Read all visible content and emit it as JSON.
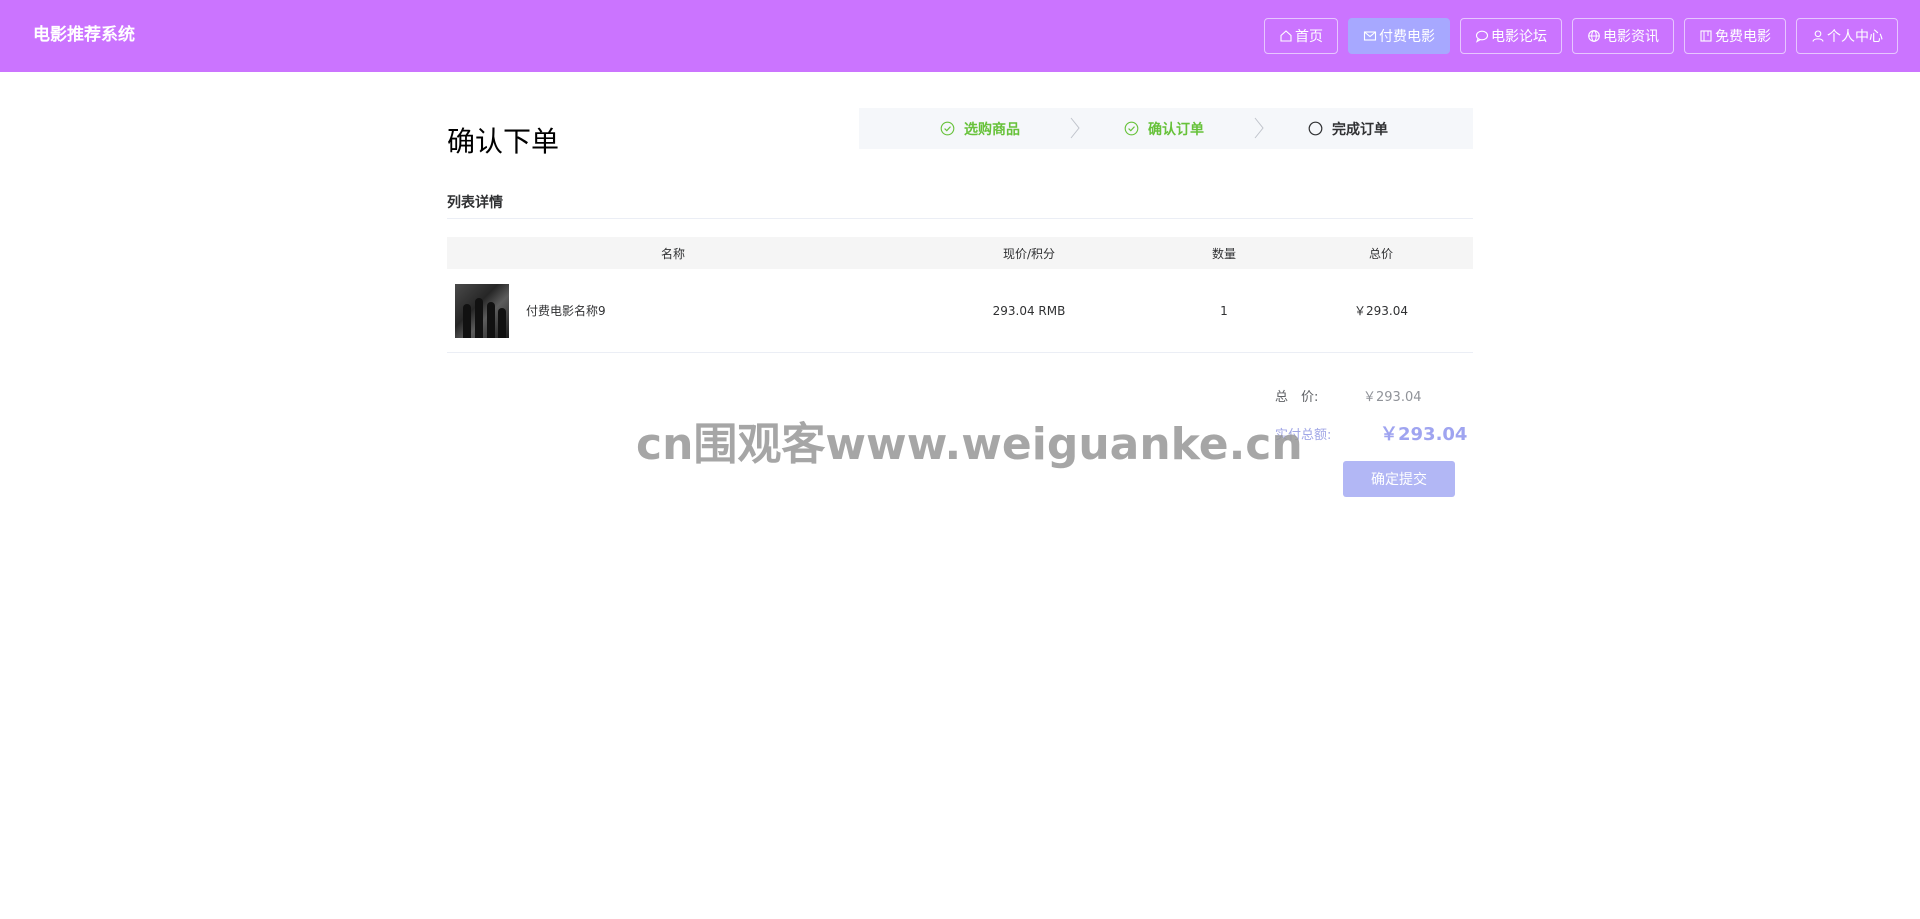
{
  "header": {
    "brand": "电影推荐系统",
    "nav": [
      {
        "label": "首页",
        "icon": "home-icon"
      },
      {
        "label": "付费电影",
        "icon": "mail-icon",
        "active": true
      },
      {
        "label": "电影论坛",
        "icon": "chat-icon"
      },
      {
        "label": "电影资讯",
        "icon": "globe-icon"
      },
      {
        "label": "免费电影",
        "icon": "tag-icon"
      },
      {
        "label": "个人中心",
        "icon": "user-icon"
      }
    ],
    "colors": {
      "background": "#cb74ff",
      "active": "#a7a8ff"
    }
  },
  "page": {
    "title": "确认下单"
  },
  "steps": [
    {
      "label": "选购商品",
      "status": "done",
      "icon": "check-circle-icon"
    },
    {
      "label": "确认订单",
      "status": "done",
      "icon": "check-circle-icon"
    },
    {
      "label": "完成订单",
      "status": "current",
      "icon": "circle-icon"
    }
  ],
  "section": {
    "title": "列表详情"
  },
  "table": {
    "headers": [
      "名称",
      "现价/积分",
      "数量",
      "总价"
    ],
    "rows": [
      {
        "name": "付费电影名称9",
        "price": "293.04 RMB",
        "qty": "1",
        "total": "￥293.04"
      }
    ]
  },
  "summary": {
    "total_label": "总　价:",
    "total_value": "￥293.04",
    "pay_label": "实付总额:",
    "pay_value": "￥293.04",
    "submit_label": "确定提交"
  },
  "watermark": "cn围观客www.weiguanke.cn"
}
